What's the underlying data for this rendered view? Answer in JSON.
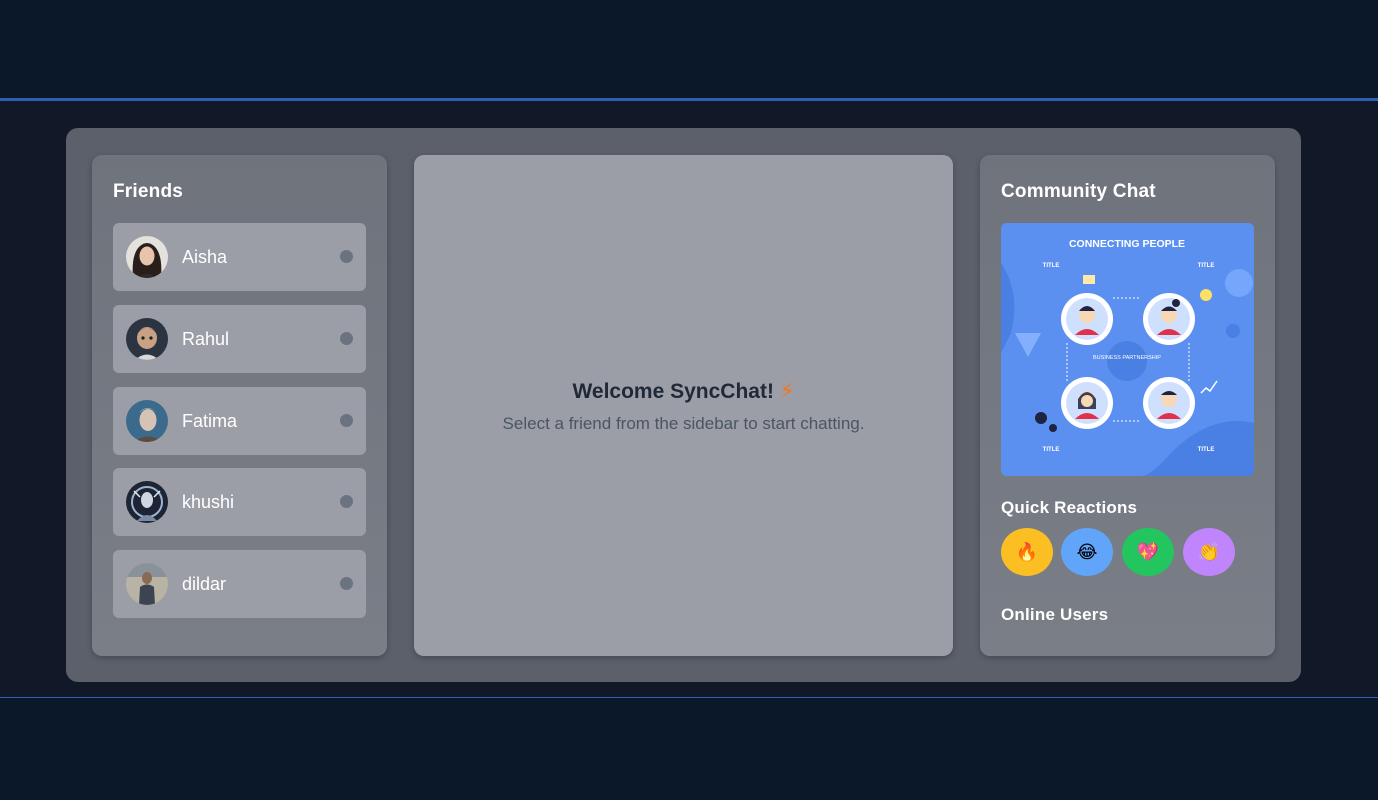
{
  "app": {
    "name": "SyncChat"
  },
  "sidebar": {
    "title": "Friends",
    "friends": [
      {
        "name": "Aisha",
        "status": "offline"
      },
      {
        "name": "Rahul",
        "status": "offline"
      },
      {
        "name": "Fatima",
        "status": "offline"
      },
      {
        "name": "khushi",
        "status": "offline"
      },
      {
        "name": "dildar",
        "status": "offline"
      }
    ]
  },
  "main": {
    "welcome_title": "Welcome SyncChat!",
    "welcome_emoji": "⚡",
    "welcome_subtitle": "Select a friend from the sidebar to start chatting."
  },
  "right": {
    "community_title": "Community Chat",
    "community_image": {
      "heading": "CONNECTING PEOPLE",
      "center_label": "BUSINESS PARTNERSHIP",
      "corner_label": "TITLE"
    },
    "reactions_title": "Quick Reactions",
    "reactions": [
      {
        "icon": "fire-icon",
        "glyph": "🔥",
        "color": "#fbbf24"
      },
      {
        "icon": "laugh-icon",
        "glyph": "😂",
        "color": "#60a5fa"
      },
      {
        "icon": "heart-icon",
        "glyph": "💖",
        "color": "#22c55e"
      },
      {
        "icon": "clap-icon",
        "glyph": "👏",
        "color": "#c084fc"
      }
    ],
    "online_users_title": "Online Users"
  },
  "colors": {
    "background": "#0b1829",
    "band": "#111827",
    "accent_line": "#2f5fb3",
    "shell": "#5b606b",
    "card": "#9b9ea6"
  }
}
